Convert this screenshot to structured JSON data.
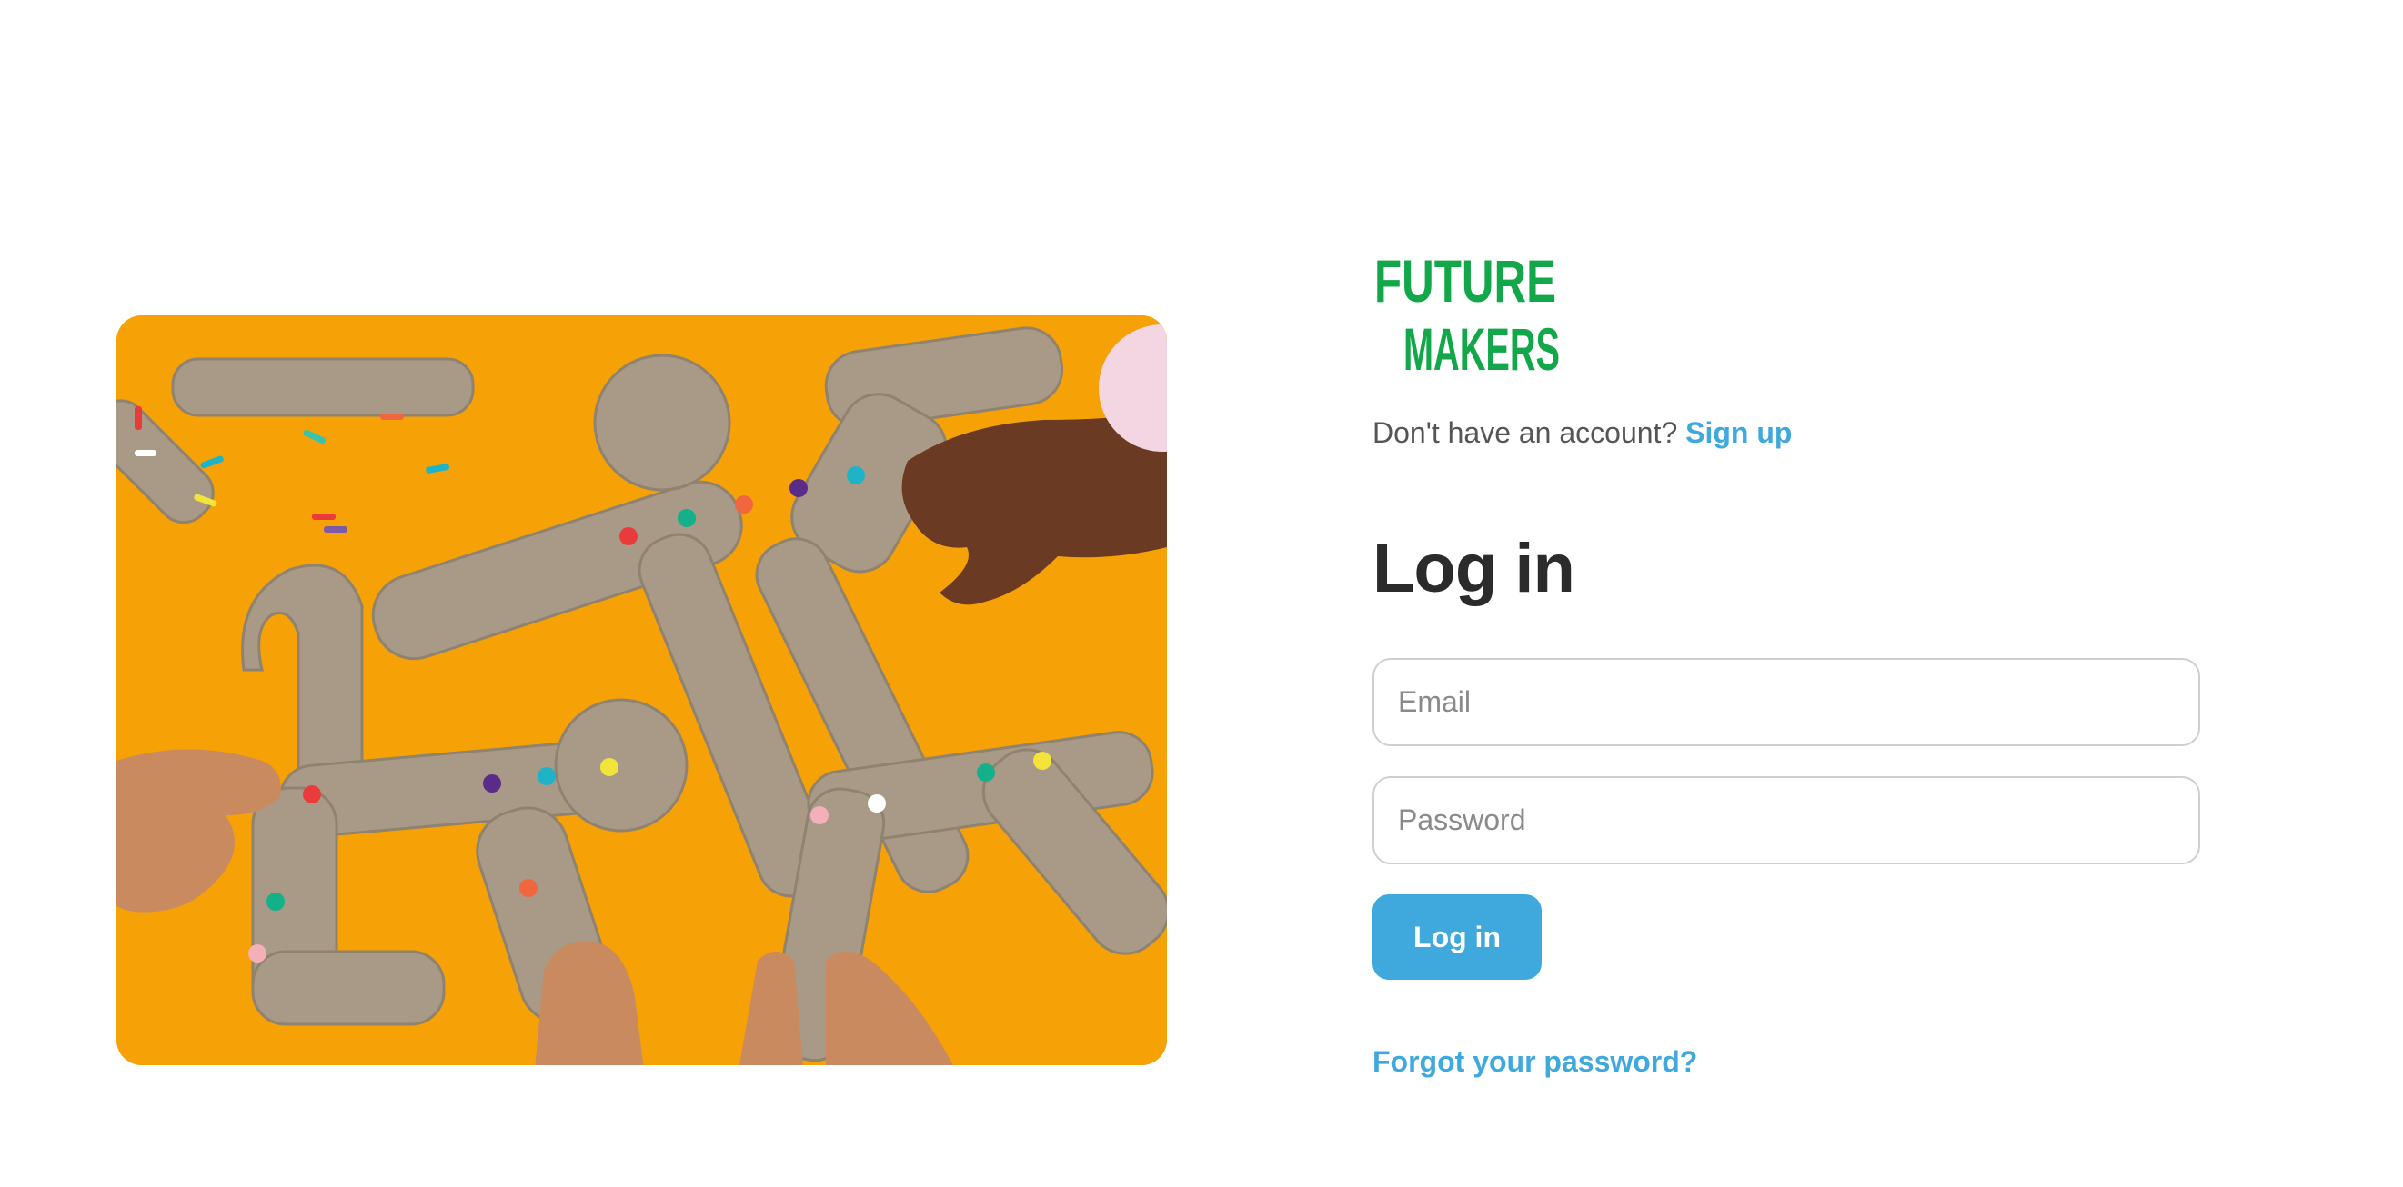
{
  "hero": {
    "alt": "Cardboard construction kit pieces joined with colorful pins on an orange background"
  },
  "logo": {
    "line1": "FUTURE",
    "line2": "MAKERS",
    "color": "#12a84a"
  },
  "signup": {
    "prompt": "Don't have an account?",
    "link_label": "Sign up"
  },
  "login": {
    "title": "Log in",
    "email_placeholder": "Email",
    "password_placeholder": "Password",
    "submit_label": "Log in",
    "forgot_label": "Forgot your password?"
  },
  "colors": {
    "accent": "#3fa9dd",
    "brand_green": "#12a84a",
    "hero_bg": "#f6a106"
  }
}
